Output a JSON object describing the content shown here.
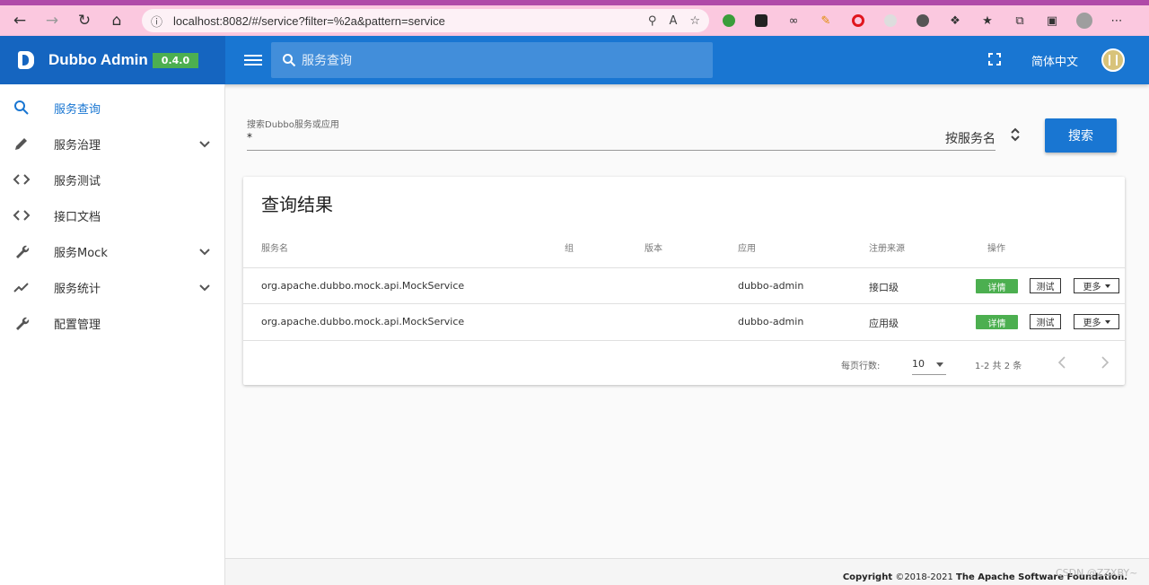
{
  "browser": {
    "url": "localhost:8082/#/service?filter=%2a&pattern=service"
  },
  "header": {
    "title": "Dubbo Admin",
    "version": "0.4.0",
    "search_placeholder": "服务查询",
    "language": "简体中文"
  },
  "sidebar": {
    "items": [
      {
        "label": "服务查询",
        "icon": "search-icon",
        "expandable": false,
        "active": true
      },
      {
        "label": "服务治理",
        "icon": "pencil-icon",
        "expandable": true,
        "active": false
      },
      {
        "label": "服务测试",
        "icon": "code-icon",
        "expandable": false,
        "active": false
      },
      {
        "label": "接口文档",
        "icon": "code-icon",
        "expandable": false,
        "active": false
      },
      {
        "label": "服务Mock",
        "icon": "wrench-icon",
        "expandable": true,
        "active": false
      },
      {
        "label": "服务统计",
        "icon": "trending-icon",
        "expandable": true,
        "active": false
      },
      {
        "label": "配置管理",
        "icon": "wrench-icon",
        "expandable": false,
        "active": false
      }
    ]
  },
  "search": {
    "label": "搜索Dubbo服务或应用",
    "value": "*",
    "mode": "按服务名",
    "button": "搜索"
  },
  "results": {
    "title": "查询结果",
    "columns": [
      "服务名",
      "组",
      "版本",
      "应用",
      "注册来源",
      "操作"
    ],
    "rows": [
      {
        "service": "org.apache.dubbo.mock.api.MockService",
        "group": "",
        "version": "",
        "app": "dubbo-admin",
        "source": "接口级"
      },
      {
        "service": "org.apache.dubbo.mock.api.MockService",
        "group": "",
        "version": "",
        "app": "dubbo-admin",
        "source": "应用级"
      }
    ],
    "actions": {
      "detail": "详情",
      "test": "测试",
      "more": "更多"
    },
    "pagination": {
      "per_page_label": "每页行数:",
      "per_page": "10",
      "range": "1-2 共 2 条"
    }
  },
  "footer": {
    "copyright_prefix": "Copyright",
    "copyright_years": "©2018-2021",
    "copyright_org": "The Apache Software Foundation."
  },
  "watermark": "CSDN @ZZXBY~",
  "colors": {
    "primary": "#1976d2",
    "brand_bg": "#1565c0",
    "version_badge": "#4caf50",
    "detail_button": "#4caf50",
    "browser_bar": "#fbc8df"
  }
}
